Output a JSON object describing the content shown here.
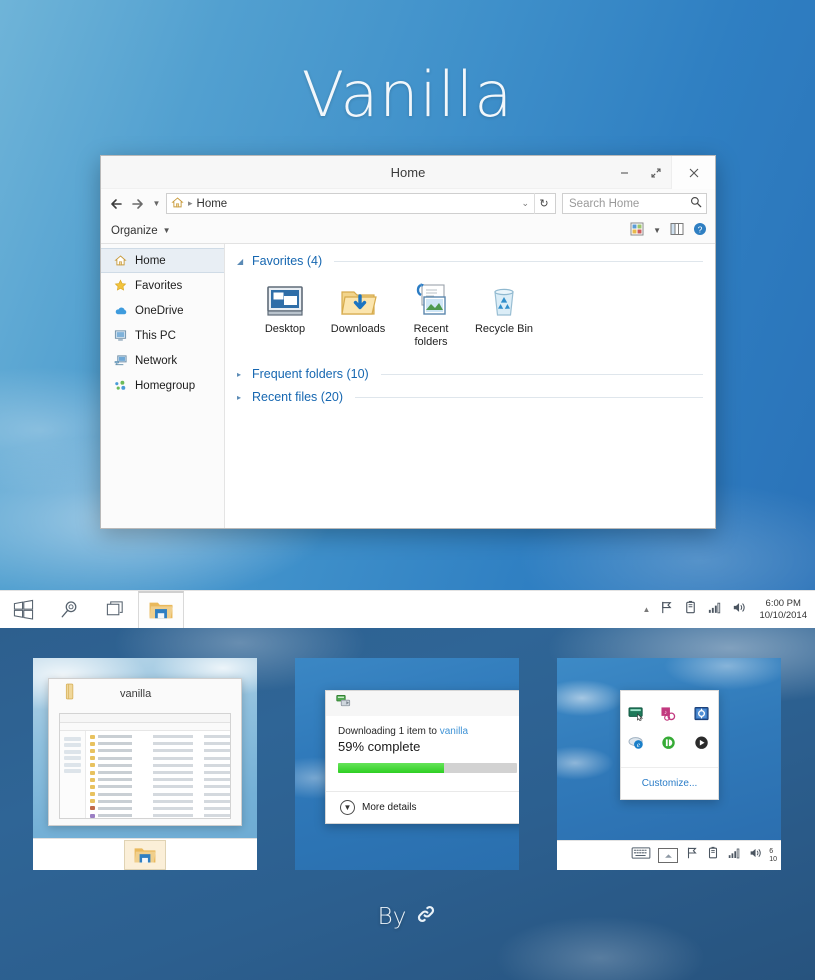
{
  "page": {
    "title": "Vanilla",
    "byline_label": "By",
    "byline_icon": "link-chain-icon"
  },
  "explorer": {
    "window_title": "Home",
    "window_buttons": {
      "minimize": "minimize-icon",
      "maximize": "maximize-restore-icon",
      "close": "close-icon"
    },
    "address": {
      "back": "back-arrow-icon",
      "forward": "forward-arrow-icon",
      "history": "history-dropdown-icon",
      "home_icon": "home-icon",
      "path": "Home",
      "dropdown": "chevron-down-icon",
      "refresh": "refresh-icon"
    },
    "search": {
      "placeholder": "Search Home",
      "icon": "search-icon"
    },
    "toolbar": {
      "organize_label": "Organize",
      "organize_caret": "caret-down-icon",
      "view_icon": "change-view-icon",
      "view_caret": "caret-down-icon",
      "preview_pane_icon": "preview-pane-icon",
      "help_icon": "help-icon"
    },
    "nav_items": [
      {
        "label": "Home",
        "icon": "home-icon",
        "selected": true
      },
      {
        "label": "Favorites",
        "icon": "star-icon",
        "selected": false
      },
      {
        "label": "OneDrive",
        "icon": "cloud-icon",
        "selected": false
      },
      {
        "label": "This PC",
        "icon": "computer-icon",
        "selected": false
      },
      {
        "label": "Network",
        "icon": "network-icon",
        "selected": false
      },
      {
        "label": "Homegroup",
        "icon": "homegroup-icon",
        "selected": false
      }
    ],
    "groups": [
      {
        "label": "Favorites (4)",
        "expanded": true,
        "triangle": "triangle-down-icon"
      },
      {
        "label": "Frequent folders (10)",
        "expanded": false,
        "triangle": "triangle-right-icon"
      },
      {
        "label": "Recent files (20)",
        "expanded": false,
        "triangle": "triangle-right-icon"
      }
    ],
    "tiles": [
      {
        "label": "Desktop",
        "icon": "desktop-monitor-icon"
      },
      {
        "label": "Downloads",
        "icon": "downloads-folder-icon"
      },
      {
        "label": "Recent folders",
        "icon": "recent-folders-icon"
      },
      {
        "label": "Recycle Bin",
        "icon": "recycle-bin-icon"
      }
    ]
  },
  "taskbar": {
    "start_icon": "windows-start-icon",
    "search_icon": "search-magnifier-icon",
    "taskview_icon": "task-view-icon",
    "explorer_icon": "file-explorer-icon",
    "tray": {
      "overflow_icon": "show-hidden-icons-icon",
      "action_center_icon": "flag-action-center-icon",
      "battery_icon": "battery-icon",
      "network_icon": "wifi-signal-icon",
      "volume_icon": "volume-speaker-icon"
    },
    "clock_time": "6:00 PM",
    "clock_date": "10/10/2014"
  },
  "panel1": {
    "name": "taskbar-thumbnail-preview",
    "mini_window_title": "vanilla",
    "mini_folder_icon": "folder-icon",
    "mini_taskbar_icon": "file-explorer-icon"
  },
  "panel2": {
    "name": "download-progress-dialog",
    "header_icon": "file-transfer-icon",
    "line1_prefix": "Downloading 1 item to ",
    "line1_link": "vanilla",
    "line2": "59% complete",
    "progress_percent": 59,
    "progress_color": "#2ecf22",
    "more_details_label": "More details",
    "more_details_icon": "chevron-down-circle-icon"
  },
  "panel3": {
    "name": "system-tray-flyout",
    "customize_label": "Customize...",
    "customize_color": "#2a7cc7",
    "icons": [
      "remote-desktop-icon",
      "media-sync-icon",
      "system-config-icon",
      "internet-explorer-icon",
      "power-indicator-icon",
      "media-play-icon"
    ],
    "tray": {
      "keyboard_icon": "touch-keyboard-icon",
      "overflow_icon": "show-hidden-icons-icon",
      "action_center_icon": "flag-action-center-icon",
      "battery_icon": "battery-icon",
      "network_icon": "wifi-signal-icon",
      "volume_icon": "volume-speaker-icon"
    },
    "clock_partial": "6",
    "date_partial": "10"
  },
  "colors": {
    "accent_blue": "#1667b1",
    "link_blue": "#2a7cc7",
    "sky_top": "#6fb4d8",
    "sky_bottom": "#2a72b8",
    "progress_green": "#2ecf22"
  }
}
